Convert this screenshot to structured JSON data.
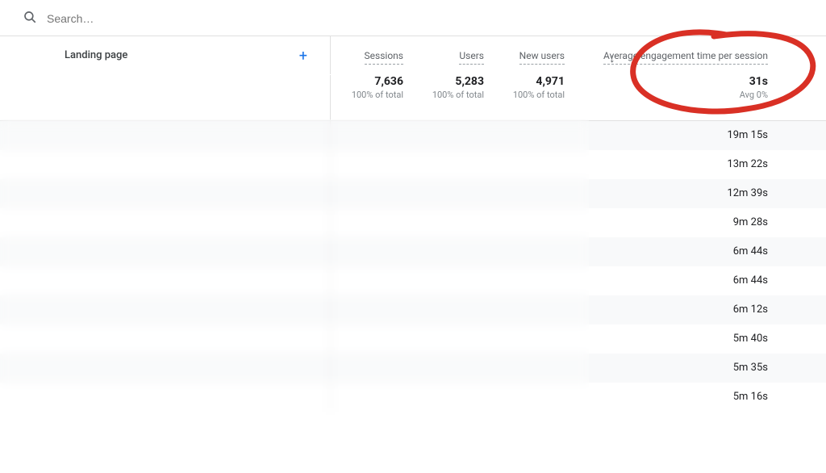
{
  "search": {
    "placeholder": "Search…"
  },
  "columns": {
    "dimension": "Landing page",
    "sessions": "Sessions",
    "users": "Users",
    "new_users": "New users",
    "aet": "Average engagement time per session"
  },
  "totals": {
    "sessions": {
      "value": "7,636",
      "sub": "100% of total"
    },
    "users": {
      "value": "5,283",
      "sub": "100% of total"
    },
    "new_users": {
      "value": "4,971",
      "sub": "100% of total"
    },
    "aet": {
      "value": "31s",
      "sub": "Avg 0%"
    }
  },
  "rows": [
    {
      "aet": "19m 15s"
    },
    {
      "aet": "13m 22s"
    },
    {
      "aet": "12m 39s"
    },
    {
      "aet": "9m 28s"
    },
    {
      "aet": "6m 44s"
    },
    {
      "aet": "6m 44s"
    },
    {
      "aet": "6m 12s"
    },
    {
      "aet": "5m 40s"
    },
    {
      "aet": "5m 35s"
    },
    {
      "aet": "5m 16s"
    }
  ]
}
